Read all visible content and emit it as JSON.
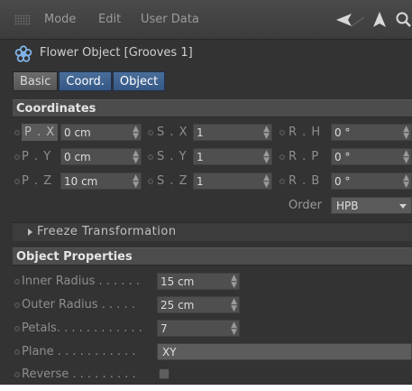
{
  "menubar": {
    "items": [
      "Mode",
      "Edit",
      "User Data"
    ],
    "icons": [
      "back-arrow-icon",
      "up-arrow-icon",
      "search-icon"
    ]
  },
  "object": {
    "title": "Flower Object [Grooves 1]",
    "icon": "flower-icon"
  },
  "tabs": [
    {
      "label": "Basic",
      "active": false
    },
    {
      "label": "Coord.",
      "active": true
    },
    {
      "label": "Object",
      "active": true
    }
  ],
  "coordinates": {
    "header": "Coordinates",
    "rows": [
      {
        "p_label": "P . X",
        "p_value": "0 cm",
        "s_label": "S . X",
        "s_value": "1",
        "r_label": "R . H",
        "r_value": "0 °"
      },
      {
        "p_label": "P . Y",
        "p_value": "0 cm",
        "s_label": "S . Y",
        "s_value": "1",
        "r_label": "R . P",
        "r_value": "0 °"
      },
      {
        "p_label": "P . Z",
        "p_value": "10 cm",
        "s_label": "S . Z",
        "s_value": "1",
        "r_label": "R . B",
        "r_value": "0 °"
      }
    ],
    "order_label": "Order",
    "order_value": "HPB",
    "freeze_label": "Freeze Transformation"
  },
  "object_properties": {
    "header": "Object Properties",
    "inner_radius": {
      "label": "Inner Radius . . . . . .",
      "value": "15 cm"
    },
    "outer_radius": {
      "label": "Outer Radius . . . . .",
      "value": "25 cm"
    },
    "petals": {
      "label": "Petals. . . . . . . . . . . .",
      "value": "7"
    },
    "plane": {
      "label": "Plane . . . . . . . . . . .",
      "value": "XY"
    },
    "reverse": {
      "label": "Reverse . . . . . . . . .",
      "checked": false
    }
  }
}
